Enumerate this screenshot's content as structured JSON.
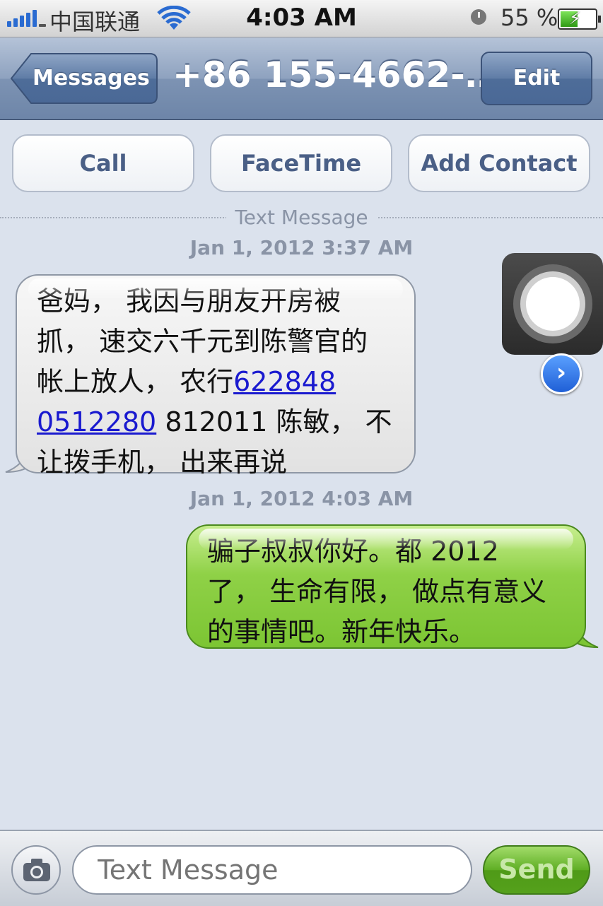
{
  "status_bar": {
    "carrier": "中国联通",
    "time": "4:03 AM",
    "battery_percent": "55 %",
    "battery_level": 0.55,
    "icons": [
      "signal-icon",
      "wifi-icon",
      "clock-icon",
      "battery-charging-icon"
    ]
  },
  "nav": {
    "back_label": "Messages",
    "title": "+86 155-4662-…",
    "edit_label": "Edit"
  },
  "actions": {
    "call": "Call",
    "facetime": "FaceTime",
    "add_contact": "Add Contact"
  },
  "thread": {
    "divider_label": "Text Message",
    "messages": [
      {
        "timestamp": "Jan 1, 2012 3:37 AM",
        "direction": "incoming",
        "lines": [
          "爸妈， 我因与朋友开房被",
          "抓， 速交六千元到陈警官的",
          "帐上放人， 农行"
        ],
        "link1": "622848",
        "link2": "0512280",
        "after_link": " 812011 陈敏， 不",
        "last_line": "让拨手机， 出来再说"
      },
      {
        "timestamp": "Jan 1, 2012 4:03 AM",
        "direction": "outgoing",
        "lines": [
          "骗子叔叔你好。都 2012",
          "了， 生命有限， 做点有意义",
          "的事情吧。新年快乐。"
        ]
      }
    ]
  },
  "composer": {
    "placeholder": "Text Message",
    "send_label": "Send"
  },
  "colors": {
    "background": "#dbe2ed",
    "navbar": "#6d85a8",
    "outgoing_bubble": "#7cc533",
    "incoming_bubble": "#e2e2e2",
    "link": "#1a1acf"
  }
}
